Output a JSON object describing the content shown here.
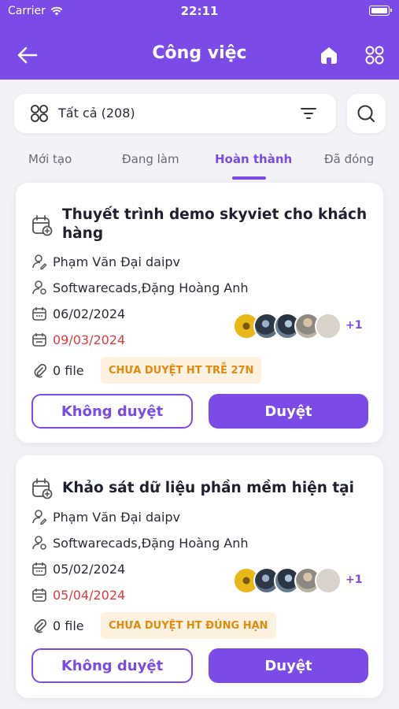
{
  "status_bar": {
    "carrier": "Carrier",
    "time": "22:11"
  },
  "header": {
    "title": "Công việc"
  },
  "filter": {
    "label": "Tất cả (208)"
  },
  "tabs": [
    {
      "label": "Mới tạo"
    },
    {
      "label": "Đang làm"
    },
    {
      "label": "Hoàn thành",
      "active": true
    },
    {
      "label": "Đã đóng"
    }
  ],
  "tasks": [
    {
      "title": "Thuyết trình demo skyviet cho khách hàng",
      "creator": "Phạm Văn Đại daipv",
      "assignees": "Softwarecads,Đặng Hoàng Anh",
      "start_date": "06/02/2024",
      "due_date": "09/03/2024",
      "extra_members": "+1",
      "files": "0 file",
      "status": "CHƯA DUYỆT HT TRỄ 27N",
      "reject_label": "Không duyệt",
      "approve_label": "Duyệt"
    },
    {
      "title": "Khảo sát dữ liệu phần mềm hiện tại",
      "creator": "Phạm Văn Đại daipv",
      "assignees": "Softwarecads,Đặng Hoàng Anh",
      "start_date": "05/02/2024",
      "due_date": "05/04/2024",
      "extra_members": "+1",
      "files": "0 file",
      "status": "CHƯA DUYỆT HT ĐÚNG HẠN",
      "reject_label": "Không duyệt",
      "approve_label": "Duyệt"
    }
  ],
  "colors": {
    "primary": "#7a4be6",
    "due_date": "#e03a3a",
    "badge_text": "#e08a10",
    "badge_bg": "#fdf1e0"
  }
}
